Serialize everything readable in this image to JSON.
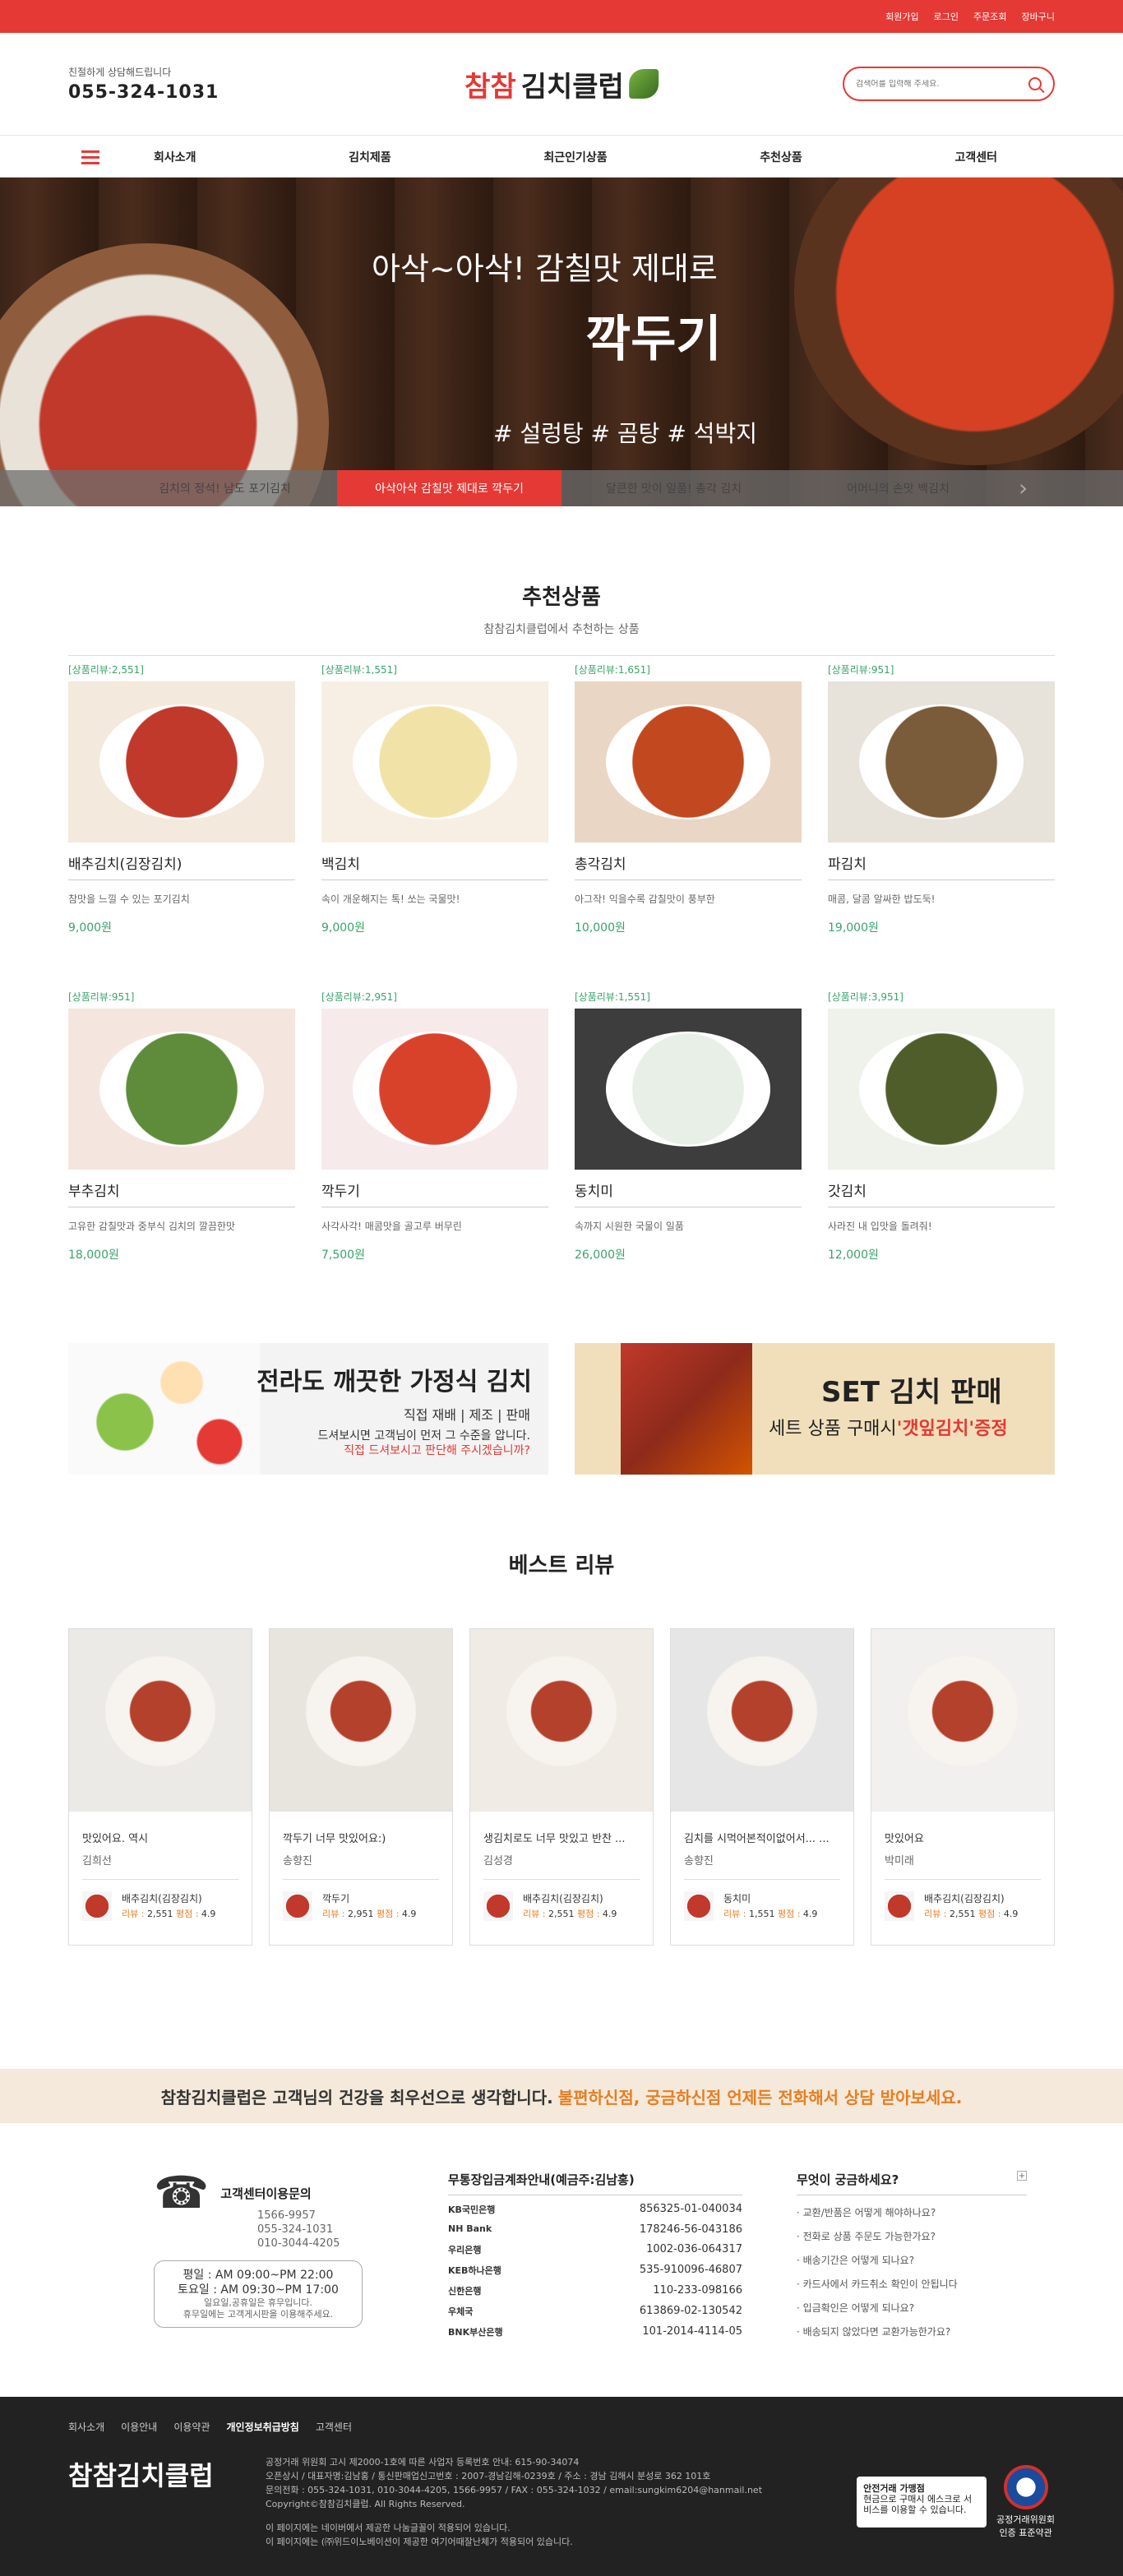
{
  "topbar": {
    "links": [
      "회원가입",
      "로그인",
      "주문조회",
      "장바구니"
    ],
    "color": "#e53935"
  },
  "header": {
    "phone_caption": "친절하게 상담해드립니다",
    "phone": "055-324-1031",
    "logo_red": "참참",
    "logo_dark": "김치클럽",
    "search_placeholder": "검색어를 입력해 주세요."
  },
  "nav": {
    "items": [
      "회사소개",
      "김치제품",
      "최근인기상품",
      "추천상품",
      "고객센터"
    ]
  },
  "hero": {
    "line1": "아삭~아삭! 감칠맛 제대로",
    "line2": "깍두기",
    "line3": "# 설렁탕 # 곰탕 # 석박지",
    "tabs": [
      "김치의 정석! 남도 포기김치",
      "아삭아삭 감칠맛 제대로 깍두기",
      "달큰한 맛이 일품! 총각 김치",
      "어머니의 손맛 백김치"
    ],
    "active_tab": 1
  },
  "recommend": {
    "title": "추천상품",
    "subtitle": "참참김치클럽에서 추천하는 상품",
    "products": [
      {
        "review": "[상품리뷰:2,551]",
        "name": "배추김치(김장김치)",
        "desc": "참맛을 느낄 수 있는 포기김치",
        "price": "9,000원"
      },
      {
        "review": "[상품리뷰:1,551]",
        "name": "백김치",
        "desc": "속이 개운해지는 톡! 쏘는 국물맛!",
        "price": "9,000원"
      },
      {
        "review": "[상품리뷰:1,651]",
        "name": "총각김치",
        "desc": "아그작! 익을수록 감칠맛이 풍부한",
        "price": "10,000원"
      },
      {
        "review": "[상품리뷰:951]",
        "name": "파김치",
        "desc": "매콤, 달콤 알싸한 밥도둑!",
        "price": "19,000원"
      },
      {
        "review": "[상품리뷰:951]",
        "name": "부추김치",
        "desc": "고유한 감칠맛과 중부식 김치의 깔끔한맛",
        "price": "18,000원"
      },
      {
        "review": "[상품리뷰:2,951]",
        "name": "깍두기",
        "desc": "사각사각! 매콤맛을 골고루 버무린",
        "price": "7,500원"
      },
      {
        "review": "[상품리뷰:1,551]",
        "name": "동치미",
        "desc": "속까지 시원한 국물이 일품",
        "price": "26,000원"
      },
      {
        "review": "[상품리뷰:3,951]",
        "name": "갓김치",
        "desc": "사라진 내 입맛을 돌려줘!",
        "price": "12,000원"
      }
    ]
  },
  "banners": {
    "b1": {
      "title": "전라도 깨끗한 가정식 김치",
      "line1": "직접 재배 | 제조 | 판매",
      "line2": "드셔보시면 고객님이 먼저 그 수준을 압니다.",
      "line3": "직접 드셔보시고 판단해 주시겠습니까?"
    },
    "b2": {
      "title": "SET 김치 판매",
      "line_prefix": "세트 상품 구매시",
      "line_highlight": "'갯잎김치'증정"
    }
  },
  "best": {
    "title": "베스트 리뷰",
    "reviews": [
      {
        "title": "맛있어요. 역시",
        "author": "김희선",
        "product": "배추김치(김장김치)",
        "review_label": "리뷰 :",
        "review": "2,551",
        "score_label": "평점 :",
        "score": "4.9"
      },
      {
        "title": "깍두기 너무 맛있어요:)",
        "author": "송향진",
        "product": "깍두기",
        "review_label": "리뷰 :",
        "review": "2,951",
        "score_label": "평점 :",
        "score": "4.9"
      },
      {
        "title": "생김치로도 너무 맛있고 반찬 ...",
        "author": "김성경",
        "product": "배추김치(김장김치)",
        "review_label": "리뷰 :",
        "review": "2,551",
        "score_label": "평점 :",
        "score": "4.9"
      },
      {
        "title": "김치를 시먹어본적이없어서... ...",
        "author": "송향진",
        "product": "동치미",
        "review_label": "리뷰 :",
        "review": "1,551",
        "score_label": "평점 :",
        "score": "4.9"
      },
      {
        "title": "맛있어요",
        "author": "박미래",
        "product": "배추김치(김장김치)",
        "review_label": "리뷰 :",
        "review": "2,551",
        "score_label": "평점 :",
        "score": "4.9"
      }
    ]
  },
  "cs_banner": {
    "main": "참참김치클럽은 고객님의 건강을 최우선으로 생각합니다.",
    "accent": "불편하신점, 궁금하신점 언제든 전화해서 상담 받아보세요."
  },
  "callcenter": {
    "title": "고객센터이용문의",
    "nums": [
      "1566-9957",
      "055-324-1031",
      "010-3044-4205"
    ],
    "hours1": "평일 : AM 09:00~PM 22:00",
    "hours2": "토요일 : AM 09:30~PM 17:00",
    "hours3": "일요일,공휴일은 휴무입니다.",
    "hours4": "휴무일에는 고객게시판을 이용해주세요."
  },
  "bank": {
    "title": "무통장입금계좌안내(예금주:김남홍)",
    "rows": [
      {
        "bank": "KB국민은행",
        "acct": "856325-01-040034"
      },
      {
        "bank": "NH Bank",
        "acct": "178246-56-043186"
      },
      {
        "bank": "우리은행",
        "acct": "1002-036-064317"
      },
      {
        "bank": "KEB하나은행",
        "acct": "535-910096-46807"
      },
      {
        "bank": "신한은행",
        "acct": "110-233-098166"
      },
      {
        "bank": "우체국",
        "acct": "613869-02-130542"
      },
      {
        "bank": "BNK부산은행",
        "acct": "101-2014-4114-05"
      }
    ]
  },
  "faq": {
    "title": "무엇이 궁금하세요?",
    "plus": "+",
    "items": [
      "교환/반품은 어떻게 해야하나요?",
      "전화로 상품 주문도 가능한가요?",
      "배송기간은 어떻게 되나요?",
      "카드사에서 카드취소 확인이 안됩니다",
      "입금확인은 어떻게 되나요?",
      "배송되지 않았다면 교환가능한가요?"
    ]
  },
  "footer": {
    "links": [
      "회사소개",
      "이용안내",
      "이용약관",
      "개인정보취급방침",
      "고객센터"
    ],
    "logo": "참참김치클럽",
    "addr": [
      "공정거래 위원회 고시 제2000-1호에 따른 사업자 등록번호 안내: 615-90-34074",
      "오픈상시 / 대표자명:김남홍 / 통신판매업신고번호 : 2007-경남김해-0239호 / 주소 : 경남 김해시 분성로 362 101호",
      "문의전화 : 055-324-1031, 010-3044-4205, 1566-9957 / FAX : 055-324-1032 / email:sungkim6204@hanmail.net",
      "Copyright©참참김치클럽. All Rights Reserved."
    ],
    "notice1": "이 페이지에는 네이버에서 제공한 나눔글꼴이 적용되어 있습니다.",
    "notice2": "이 페이지에는 (㈜위드이노베이션이 제공한 여기어때잘난체가 적용되어 있습니다.",
    "mark1_title": "안전거래 가맹점",
    "mark1_desc": "현금으로 구매시 에스크로 서비스를 이용할 수 있습니다.",
    "mark2a": "공정거래위원회",
    "mark2b": "인증 표준약관"
  }
}
